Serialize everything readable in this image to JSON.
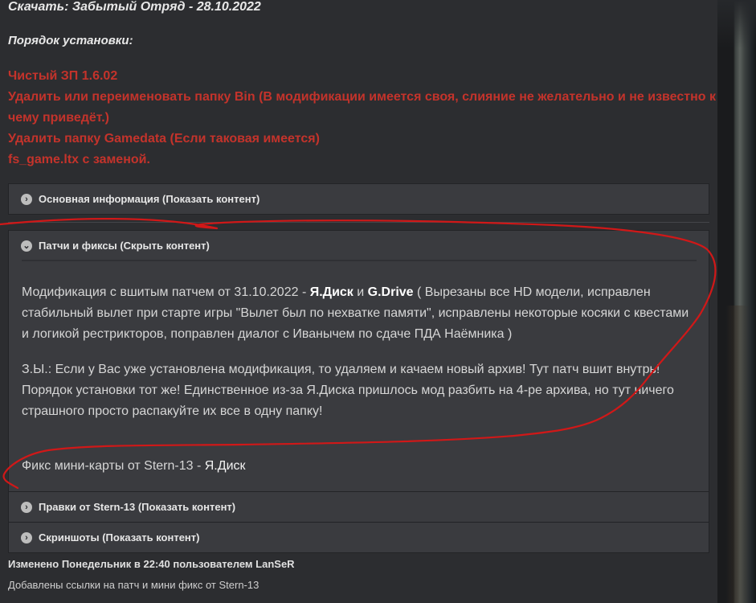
{
  "download_title": "Скачать: Забытый Отряд - 28.10.2022",
  "install_order_title": "Порядок установки:",
  "install_steps": [
    "Чистый ЗП 1.6.02",
    "Удалить или переименовать папку Bin (В модификации имеется своя, слияние не желательно и не известно к",
    "чему приведёт.)",
    "Удалить папку Gamedata (Если таковая имеется)",
    "fs_game.ltx с заменой."
  ],
  "spoilers": {
    "main_info": {
      "label": "Основная информация (Показать контент)",
      "icon": "chevron-right-icon"
    },
    "patches": {
      "label": "Патчи и фиксы (Скрыть контент)",
      "icon": "chevron-down-icon"
    },
    "stern_edits": {
      "label": "Правки от Stern-13 (Показать контент)",
      "icon": "chevron-right-icon"
    },
    "screenshots": {
      "label": "Скриншоты (Показать контент)",
      "icon": "chevron-right-icon"
    }
  },
  "patches_content": {
    "p1_before": "Модификация с вшитым патчем от 31.10.2022 - ",
    "link_yadisk": "Я.Диск",
    "p1_and": " и ",
    "link_gdrive": "G.Drive",
    "p1_after": " ( Вырезаны все HD модели, исправлен стабильный вылет при старте игры \"Вылет был по нехватке памяти\", исправлены некоторые косяки с квестами и логикой рестрикторов, поправлен диалог с Иванычем по сдаче ПДА Наёмника )",
    "p2": "З.Ы.: Если у Вас уже установлена модификация, то удаляем и качаем новый архив! Тут патч вшит внутрь! Порядок установки тот же! Единственное из-за Я.Диска пришлось мод разбить на 4-ре архива, но тут ничего страшного просто распакуйте их все в одну папку!",
    "fix_label": "Фикс мини-карты от Stern-13 - ",
    "fix_link": "Я.Диск"
  },
  "edit_notice": "Изменено Понедельник в 22:40 пользователем LanSeR",
  "edit_reason": "Добавлены ссылки на патч и мини фикс от Stern-13",
  "colors": {
    "background": "#2c2d30",
    "spoiler_bg": "#3a3b3f",
    "red_text": "#c4332b",
    "marker": "#d01818"
  }
}
